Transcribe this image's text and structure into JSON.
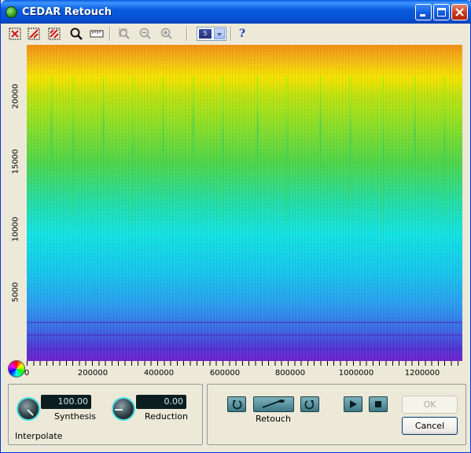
{
  "window": {
    "title": "CEDAR Retouch",
    "controls": [
      "minimize",
      "maximize",
      "close"
    ]
  },
  "toolbar": {
    "tools": [
      "select-region-icon",
      "select-freehand-icon",
      "select-harmonic-icon",
      "zoom-icon",
      "view-ruler-icon",
      "zoom-fit-icon",
      "zoom-out-icon",
      "zoom-in-icon"
    ],
    "combo_value": "5",
    "help_label": "?"
  },
  "plot": {
    "y_ticks": [
      "5000",
      "10000",
      "15000",
      "20000"
    ],
    "x_ticks": [
      "0",
      "200000",
      "400000",
      "600000",
      "800000",
      "1000000",
      "1200000"
    ],
    "colors": {
      "high": "#f58c14",
      "mid": "#12e6e6",
      "low": "#7020d0"
    }
  },
  "left_panel": {
    "synthesis_value": "100.00",
    "synthesis_label": "Synthesis",
    "reduction_value": "0.00",
    "reduction_label": "Reduction",
    "mode_label": "Interpolate"
  },
  "right_panel": {
    "retouch_label": "Retouch",
    "ok_label": "OK",
    "cancel_label": "Cancel"
  }
}
